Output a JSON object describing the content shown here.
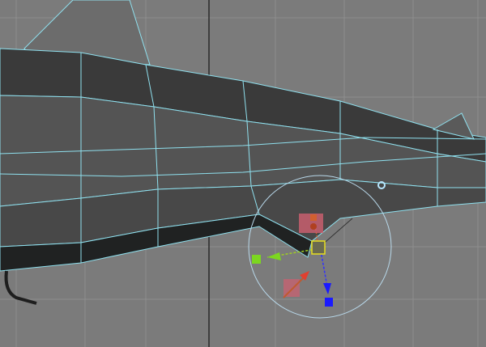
{
  "viewport": {
    "background_color": "#7b7b7b",
    "grid_color": "#8e8e8e",
    "origin_axis_color": "#2a2a2a",
    "wireframe_color": "#8fe0ee",
    "mesh_dark_color": "#2a2c2c",
    "mesh_mid_color": "#5a5a5a"
  },
  "manipulator": {
    "x_axis_color": "#7cd620",
    "y_axis_color": "#d06030",
    "z_axis_color": "#1a1aff",
    "center_color": "#e8e020",
    "rotate_ring_color": "#b8d8ea",
    "camera_arrow_color": "#e04030"
  }
}
